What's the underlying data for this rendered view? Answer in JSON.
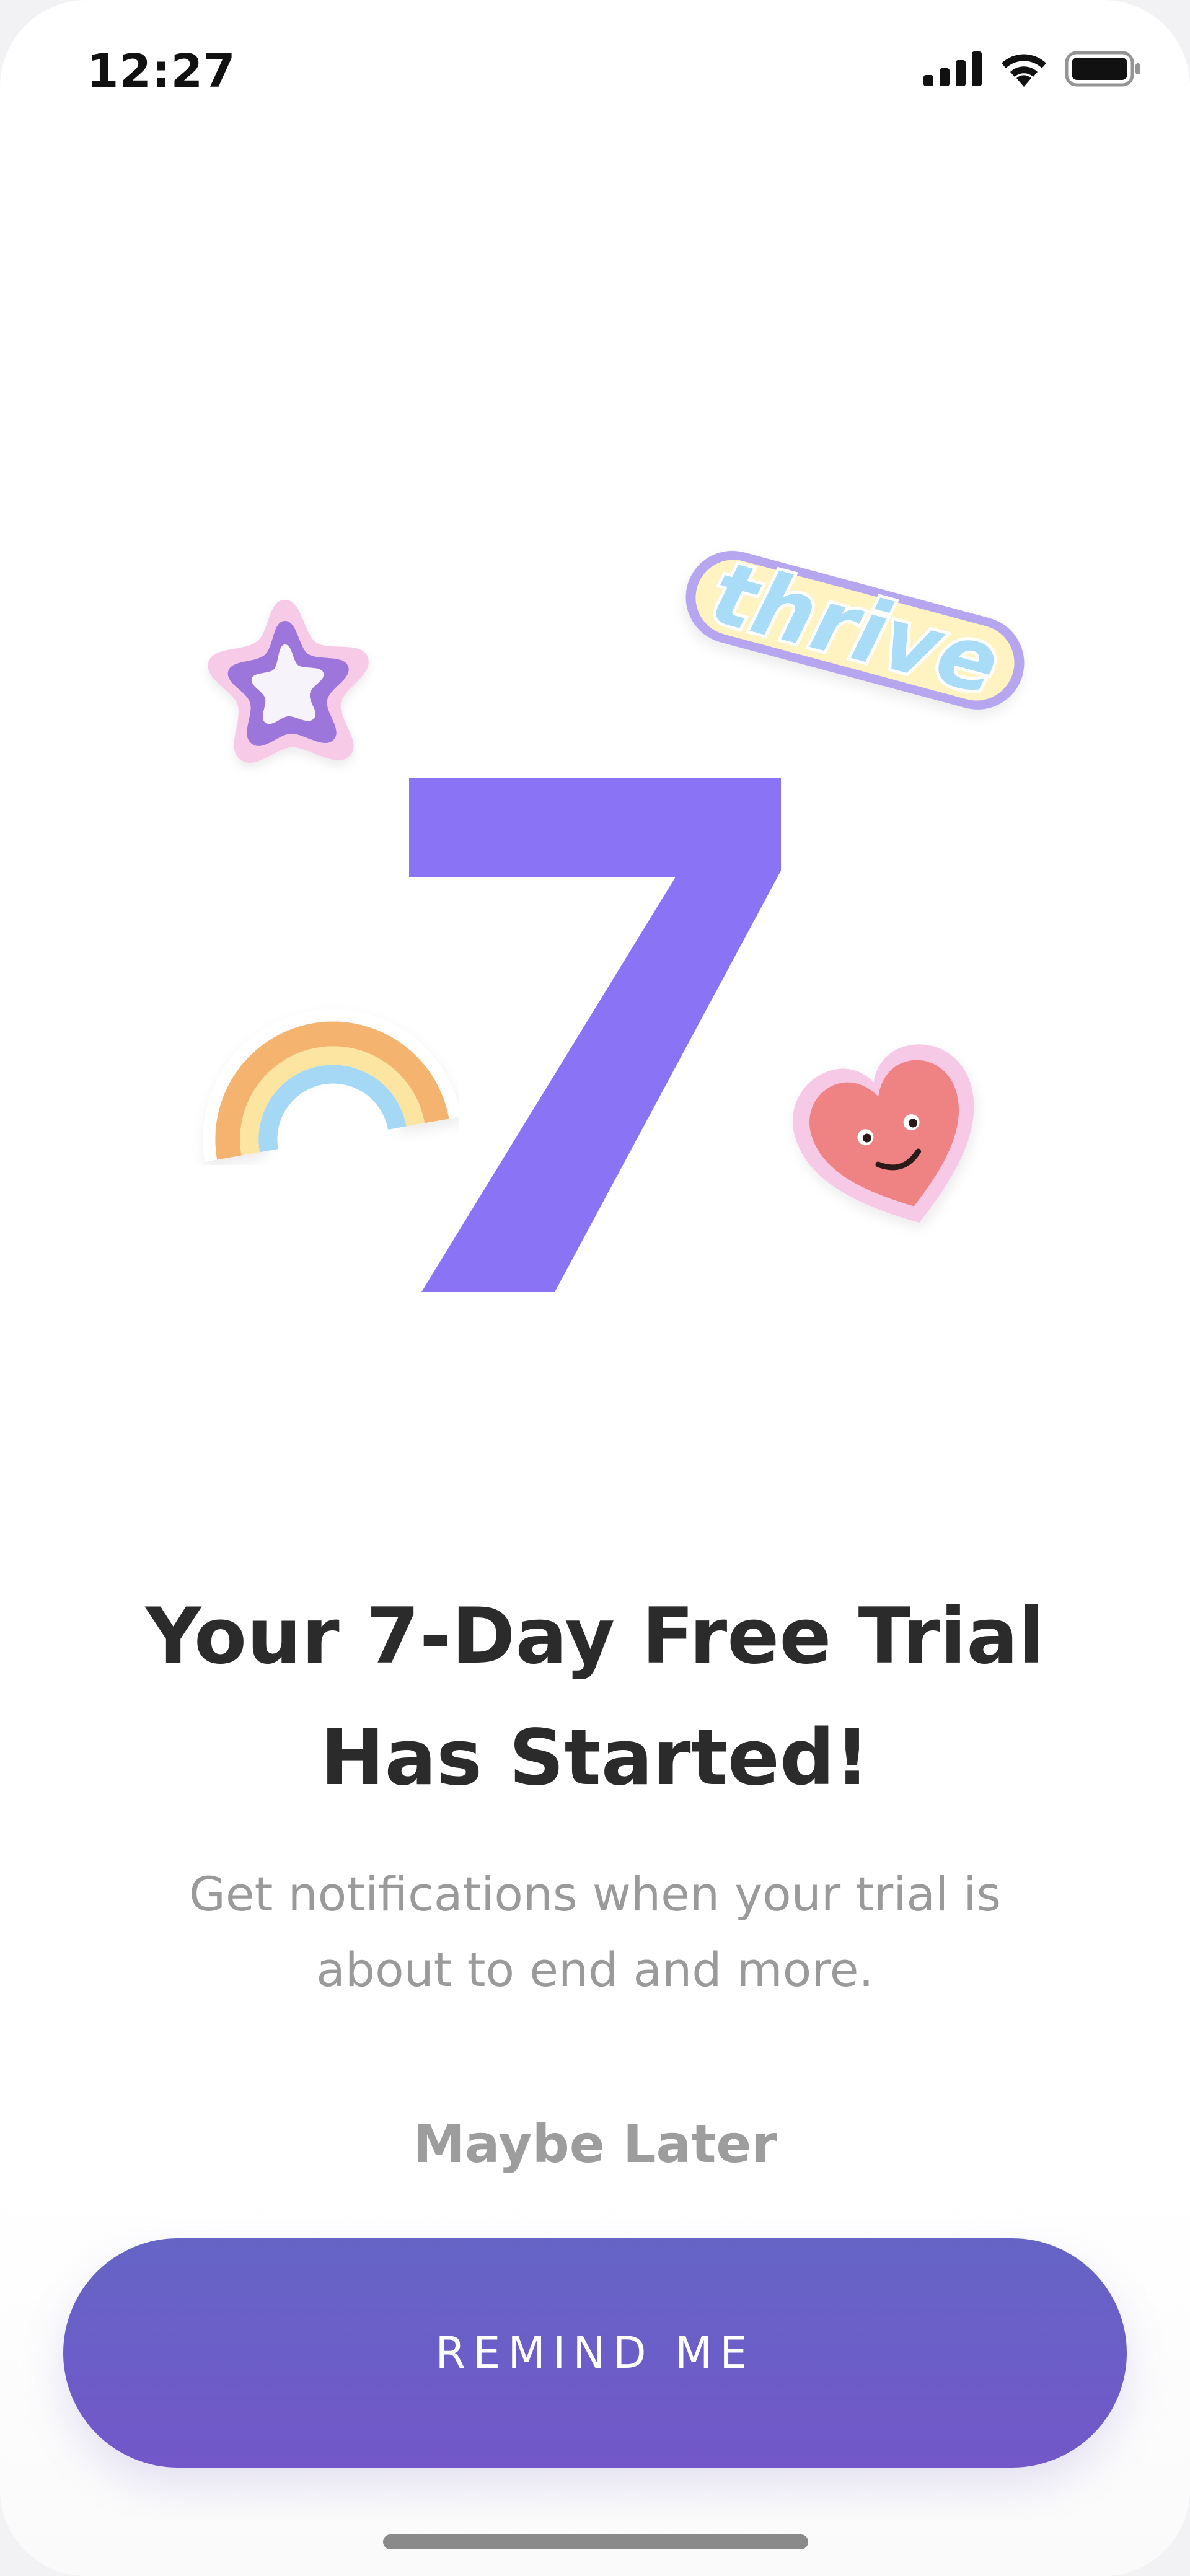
{
  "status_bar": {
    "time": "12:27",
    "icons": [
      "cellular-signal-icon",
      "wifi-icon",
      "battery-icon"
    ]
  },
  "hero": {
    "big_number": "7",
    "number_color": "#8a73f5",
    "stickers": [
      "star-sticker",
      "thrive-sticker",
      "rainbow-sticker",
      "heart-sticker"
    ],
    "sticker_text": "thrive"
  },
  "headline": "Your 7-Day Free Trial\nHas Started!",
  "subtitle": "Get notifications when your trial is\nabout to end and more.",
  "actions": {
    "secondary_label": "Maybe Later",
    "primary_label": "REMIND ME"
  },
  "colors": {
    "accent": "#6b5fc8",
    "headline": "#2b2b2b",
    "muted": "#9a9a9a"
  }
}
